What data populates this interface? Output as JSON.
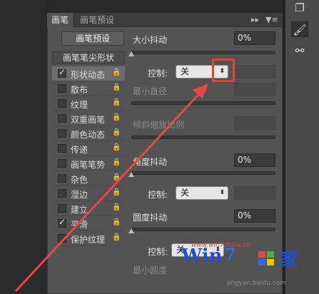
{
  "tabs": {
    "brush": "画笔",
    "brush_preset": "画笔预设",
    "controls": "▸▸",
    "menu": "▼≡"
  },
  "preset_button": "画笔预设",
  "tip_shape_header": "画笔笔尖形状",
  "options": [
    {
      "label": "形状动态",
      "checked": true,
      "selected": true
    },
    {
      "label": "散布",
      "checked": false
    },
    {
      "label": "纹理",
      "checked": false
    },
    {
      "label": "双重画笔",
      "checked": false
    },
    {
      "label": "颜色动态",
      "checked": false
    },
    {
      "label": "传递",
      "checked": false
    },
    {
      "label": "画笔笔势",
      "checked": false
    },
    {
      "label": "杂色",
      "checked": false
    },
    {
      "label": "湿边",
      "checked": false
    },
    {
      "label": "建立",
      "checked": false
    },
    {
      "label": "平滑",
      "checked": true
    },
    {
      "label": "保护纹理",
      "checked": false
    }
  ],
  "lock_glyph": "🔒",
  "size_jitter": {
    "label": "大小抖动",
    "value": "0%"
  },
  "control_label": "控制:",
  "control_value": "关",
  "min_diameter": "最小直径",
  "tilt_scale": "倾斜缩放比例",
  "angle_jitter": {
    "label": "角度抖动",
    "value": "0%"
  },
  "roundness_jitter": {
    "label": "圆度抖动",
    "value": "0%"
  },
  "min_roundness": "最小圆度",
  "watermark": {
    "win": "Win",
    "seven": "7",
    "home": "家",
    "url": "www.win7zhijia.cn",
    "site": "jingyan.baidu.com"
  }
}
